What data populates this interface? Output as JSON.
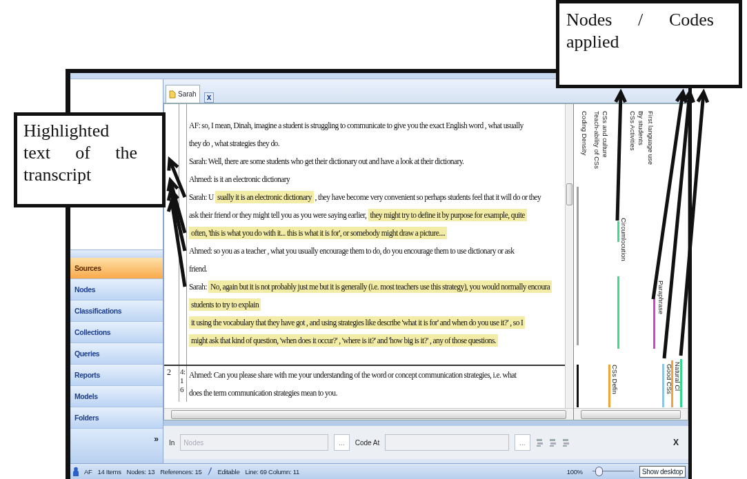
{
  "callouts": [
    {
      "kind": "left",
      "text": "Highlighted text of the transcript"
    },
    {
      "kind": "top-right",
      "text": "Nodes / Codes applied"
    }
  ],
  "document_tab": {
    "label": "Sarah",
    "selected": true,
    "close_label": "x"
  },
  "navigation": {
    "items": [
      {
        "label": "Sources",
        "selected": true
      },
      {
        "label": "Nodes",
        "selected": false
      },
      {
        "label": "Classifications",
        "selected": false
      },
      {
        "label": "Collections",
        "selected": false
      },
      {
        "label": "Queries",
        "selected": false
      },
      {
        "label": "Reports",
        "selected": false
      },
      {
        "label": "Models",
        "selected": false
      },
      {
        "label": "Folders",
        "selected": false
      }
    ],
    "more": "»"
  },
  "transcript": {
    "rows": [
      {
        "lines": [
          [
            {
              "text": "AF: so, I mean, Dinah, imagine a student is struggling to communicate to give you the exact English word , what usually",
              "highlighted": false
            }
          ],
          [
            {
              "text": "they do , what strategies they do.",
              "highlighted": false
            }
          ],
          [
            {
              "text": "Sarah: Well, there are some students who get their dictionary out and have a look at their dictionary.",
              "highlighted": false
            }
          ],
          [
            {
              "text": "Ahmed: is it an electronic dictionary",
              "highlighted": false
            }
          ],
          [
            {
              "text": "Sarah: U",
              "highlighted": false
            },
            {
              "text": "sually it is an electronic dictionary",
              "highlighted": true
            },
            {
              "text": ", they have become very convenient so perhaps students feel that it will do or they",
              "highlighted": false
            }
          ],
          [
            {
              "text": "ask their friend or they might tell you as you were saying earlier,",
              "highlighted": false
            },
            {
              "text": "they might try to define it by purpose for example, quite",
              "highlighted": true
            }
          ],
          [
            {
              "text": "often, 'this is what you do with it... this is what it is for', or somebody might draw a picture....",
              "highlighted": true
            }
          ],
          [
            {
              "text": "Ahmed: so you as a teacher , what you usually encourage them to do, do you encourage them to use dictionary or ask",
              "highlighted": false
            }
          ],
          [
            {
              "text": "friend.",
              "highlighted": false
            }
          ],
          [
            {
              "text": "Sarah:",
              "highlighted": false
            },
            {
              "text": "No, again but it is not probably just me but it is generally (i.e. most teachers use this strategy), you would normally encoura",
              "highlighted": true
            }
          ],
          [
            {
              "text": "students to try to explain",
              "highlighted": true
            }
          ],
          [
            {
              "text": "it using the vocabulary that they have got , and using strategies like describe 'what it is for' and when do you use it?' , so I",
              "highlighted": true
            }
          ],
          [
            {
              "text": "might ask that kind of question, 'when does it occur?' , 'where is it?' and 'how big is it?' , any of those questions.",
              "highlighted": true
            }
          ]
        ]
      },
      {
        "number": "2",
        "reference": "4:16",
        "lines": [
          [
            {
              "text": "Ahmed: Can you please share with me your understanding of the word or concept communication strategies, i.e. what",
              "highlighted": false
            }
          ],
          [
            {
              "text": "does the term communication strategies mean to you.",
              "highlighted": false
            }
          ]
        ]
      }
    ]
  },
  "coding_stripes": [
    {
      "kind": "density",
      "label": "Coding Density"
    },
    {
      "kind": "node",
      "label": "Teach-ability of CSs"
    },
    {
      "kind": "node",
      "label": "CSs and culture"
    },
    {
      "kind": "node",
      "label": "CSs Defin",
      "color": "#f0a43a"
    },
    {
      "kind": "node",
      "label": "Circumlocution",
      "color": "#3ddc8c"
    },
    {
      "kind": "node",
      "label": "CSs Activities"
    },
    {
      "kind": "node",
      "label": "By students"
    },
    {
      "kind": "node",
      "label": "First language use"
    },
    {
      "kind": "node",
      "label": "Paraphrase",
      "color": "#d640d2"
    },
    {
      "kind": "node",
      "label": "Good CSs",
      "color": "#8ec6e2"
    },
    {
      "kind": "node",
      "label": "Natural Cl",
      "color": "#f0a43a"
    },
    {
      "kind": "node",
      "color": "#30d88a"
    }
  ],
  "code_bar": {
    "in_label": "In",
    "in_field": {
      "placeholder": "Nodes",
      "disabled": true
    },
    "in_browse": "...",
    "code_at_label": "Code At",
    "code_at_field": {
      "disabled": true
    },
    "code_at_browse": "...",
    "close_label": "X"
  },
  "status_bar": {
    "user": "AF",
    "items": "14 Items",
    "nodes": "Nodes: 13",
    "references": "References: 15",
    "mode": "Editable",
    "position": "Line: 69 Column: 11",
    "zoom": "100%",
    "zoom_slider": {
      "level": 0.08
    },
    "tooltip": "Show desktop"
  }
}
